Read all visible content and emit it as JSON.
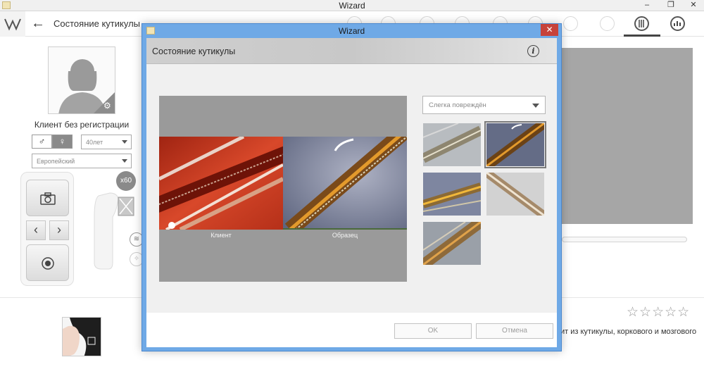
{
  "main_window": {
    "title": "Wizard",
    "page_title": "Состояние кутикулы",
    "client": {
      "name": "Клиент без регистрации",
      "gender_male": "♂",
      "gender_female": "♀",
      "age": "40лет",
      "ethnicity": "Европейский"
    },
    "zoom": "x60",
    "description_fragment": "ит из кутикулы, коркового и мозгового",
    "rating": {
      "value": 0,
      "max": 5,
      "stars": "☆☆☆☆☆"
    }
  },
  "dialog": {
    "title": "Wizard",
    "header_title": "Состояние кутикулы",
    "info_icon": "i",
    "close_icon": "✕",
    "comparison": {
      "left_label": "Клиент",
      "right_label": "Образец"
    },
    "grade_select": {
      "value": "Слегка повреждён"
    },
    "sample_count": 5,
    "selected_sample": 2,
    "buttons": {
      "ok": "OK",
      "cancel": "Отмена"
    }
  },
  "icons": {
    "back": "arrow-left-icon",
    "camera": "camera-icon",
    "prev": "chevron-left-icon",
    "next": "chevron-right-icon",
    "record": "record-icon",
    "wifi": "wifi-icon",
    "settings": "gear-icon"
  },
  "colors": {
    "dialog_frame": "#6fa9e6",
    "close_button": "#c7423a",
    "comparison_bg": "#9a9a9a",
    "accent_gray": "#8a8a8a"
  }
}
